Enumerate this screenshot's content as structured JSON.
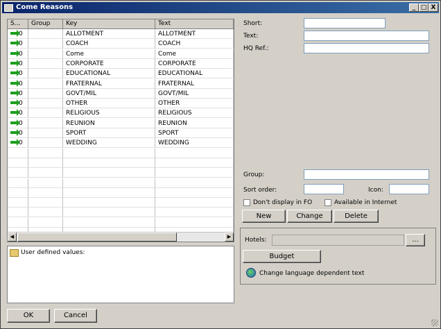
{
  "window": {
    "title": "Come Reasons",
    "minimize": "_",
    "maximize": "□",
    "close": "X"
  },
  "grid": {
    "columns": [
      "S...",
      "Group",
      "Key",
      "Text"
    ],
    "rows": [
      {
        "s": "0",
        "group": "",
        "key": "ALLOTMENT",
        "text": "ALLOTMENT"
      },
      {
        "s": "0",
        "group": "",
        "key": "COACH",
        "text": "COACH"
      },
      {
        "s": "0",
        "group": "",
        "key": "Come",
        "text": "Come"
      },
      {
        "s": "0",
        "group": "",
        "key": "CORPORATE",
        "text": "CORPORATE"
      },
      {
        "s": "0",
        "group": "",
        "key": "EDUCATIONAL",
        "text": "EDUCATIONAL"
      },
      {
        "s": "0",
        "group": "",
        "key": "FRATERNAL",
        "text": "FRATERNAL"
      },
      {
        "s": "0",
        "group": "",
        "key": "GOVT/MIL",
        "text": "GOVT/MIL"
      },
      {
        "s": "0",
        "group": "",
        "key": "OTHER",
        "text": "OTHER"
      },
      {
        "s": "0",
        "group": "",
        "key": "RELIGIOUS",
        "text": "RELIGIOUS"
      },
      {
        "s": "0",
        "group": "",
        "key": "REUNION",
        "text": "REUNION"
      },
      {
        "s": "0",
        "group": "",
        "key": "SPORT",
        "text": "SPORT"
      },
      {
        "s": "0",
        "group": "",
        "key": "WEDDING",
        "text": "WEDDING"
      }
    ],
    "scroll_left": "◀",
    "scroll_right": "▶"
  },
  "user_defined_label": "User defined values:",
  "form": {
    "short_label": "Short:",
    "text_label": "Text:",
    "hq_ref_label": "HQ Ref.:",
    "group_label": "Group:",
    "sort_order_label": "Sort order:",
    "icon_label": "Icon:",
    "dont_display_fo": "Don't display in FO",
    "available_internet": "Available in Internet",
    "short_value": "",
    "text_value": "",
    "hq_ref_value": "",
    "group_value": "",
    "sort_order_value": "",
    "icon_value": ""
  },
  "buttons": {
    "new": "New",
    "change": "Change",
    "delete": "Delete",
    "budget": "Budget",
    "ellipsis": "...",
    "ok": "OK",
    "cancel": "Cancel"
  },
  "hotels": {
    "label": "Hotels:",
    "value": ""
  },
  "language_text": "Change language dependent text"
}
